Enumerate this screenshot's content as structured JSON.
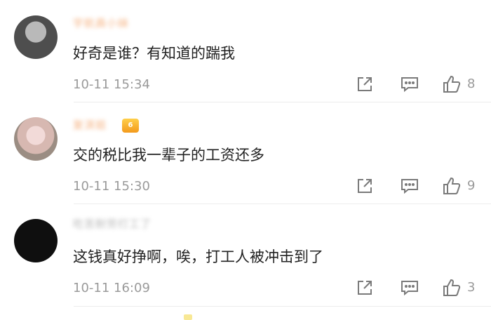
{
  "comments": [
    {
      "username": "宇航員小妹",
      "text": "好奇是谁？有知道的踹我",
      "time": "10-11 15:34",
      "likes": "8"
    },
    {
      "username": "复淇姐",
      "badge": "6",
      "text": "交的税比我一辈子的工资还多",
      "time": "10-11 15:30",
      "likes": "9"
    },
    {
      "username": "吃苦耐劳打工了",
      "text": "这钱真好挣啊，唉，打工人被冲击到了",
      "time": "10-11 16:09",
      "likes": "3"
    }
  ],
  "icons": {
    "share": "share-icon",
    "reply": "reply-icon",
    "like": "thumbs-up-icon"
  },
  "colors": {
    "username_accent": "#f29a5b",
    "text": "#222222",
    "meta": "#9a9a9a"
  }
}
